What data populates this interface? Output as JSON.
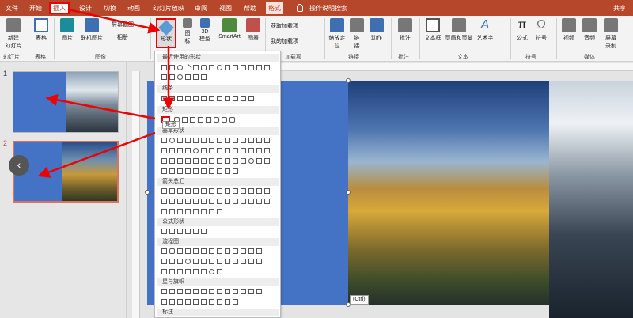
{
  "tabs": {
    "file": "文件",
    "home": "开始",
    "insert": "插入",
    "design": "设计",
    "transitions": "切换",
    "animations": "动画",
    "slideshow": "幻灯片放映",
    "review": "审阅",
    "view": "视图",
    "help": "帮助",
    "format": "格式",
    "tellme": "操作说明搜索",
    "share": "共享"
  },
  "ribbon": {
    "new_slide": "新建\n幻灯片",
    "table": "表格",
    "pictures": "图片",
    "online_pictures": "联机图片",
    "screenshot": "屏幕截图",
    "album": "相册",
    "shapes": "形状",
    "icons": "图\n标",
    "models_3d": "3D\n模型",
    "smartart": "SmartArt",
    "chart": "图表",
    "get_addins": "获取加载项",
    "my_addins": "我的加载项",
    "zoom": "缩放定\n位",
    "link": "链\n接",
    "action": "动作",
    "comment": "批注",
    "textbox": "文本框",
    "header_footer": "页眉和页脚",
    "wordart": "艺术字",
    "equation": "公式",
    "symbol": "符号",
    "video": "视频",
    "audio": "音频",
    "screen_rec": "屏幕\n录制",
    "groups": {
      "slides": "幻灯片",
      "tables": "表格",
      "images": "图像",
      "addins": "加载项",
      "links": "链接",
      "comments": "批注",
      "text": "文本",
      "symbols": "符号",
      "media": "媒体"
    }
  },
  "thumbs": {
    "n1": "1",
    "n2": "2"
  },
  "dropdown": {
    "recent": "最近使用的形状",
    "lines": "线条",
    "rect": "矩形",
    "basic": "基本形状",
    "arrows": "箭头总汇",
    "equation": "公式形状",
    "flowchart": "流程图",
    "stars": "星与旗帜",
    "callouts": "标注",
    "tooltip": "矩形"
  },
  "ctrl_tag": "(Ctrl)",
  "colors": {
    "accent": "#b7472a",
    "slide_blue": "#4472c4",
    "highlight": "#e00000"
  }
}
